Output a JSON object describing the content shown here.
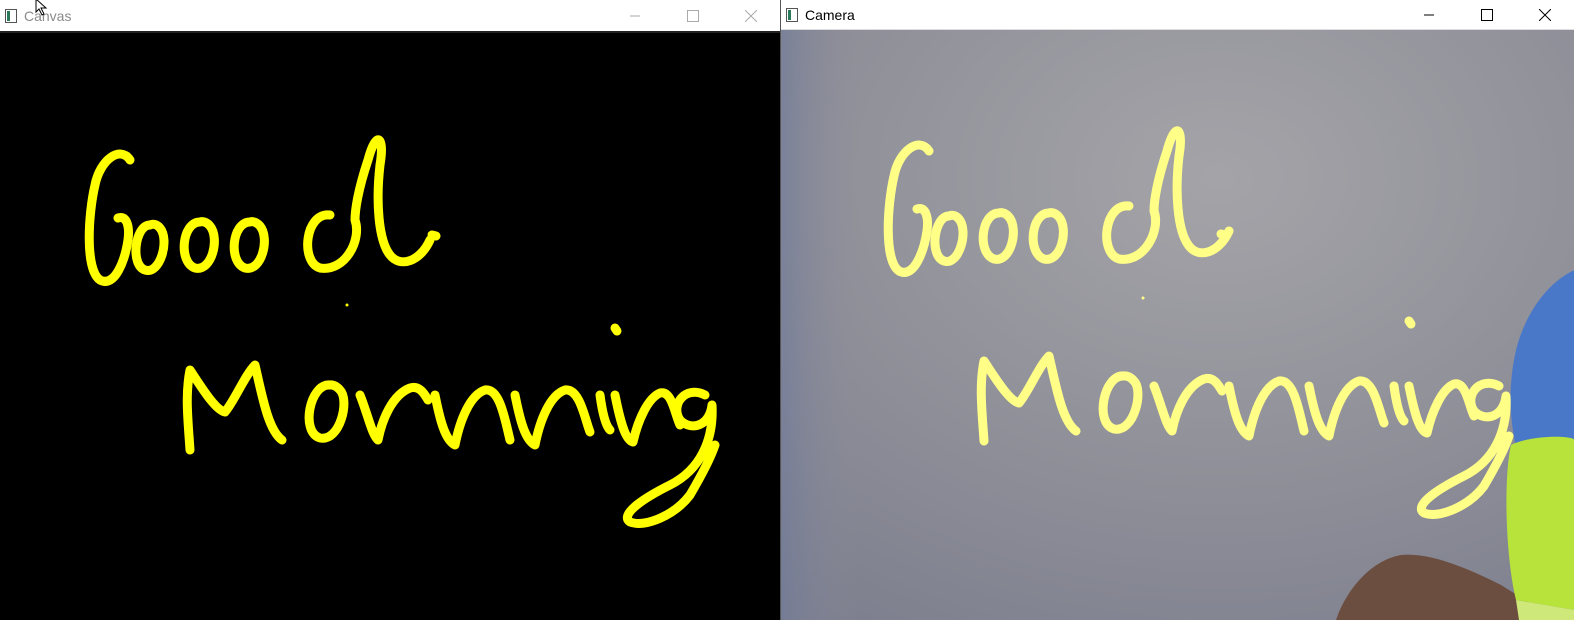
{
  "windows": {
    "canvas": {
      "title": "Canvas"
    },
    "camera": {
      "title": "Camera"
    }
  },
  "icons": {
    "app": "opencv-window-icon",
    "minimize": "minimize-icon",
    "maximize": "maximize-icon",
    "close": "close-icon",
    "cursor": "mouse-pointer-icon"
  },
  "colors": {
    "ink_canvas": "#ffff00",
    "ink_camera": "#ffff80",
    "canvas_bg": "#000000",
    "camera_wall": "#8d8d99",
    "marker_cap": "#b7e33a",
    "shirt": "#4a78c8",
    "skin": "#7a5a48"
  }
}
